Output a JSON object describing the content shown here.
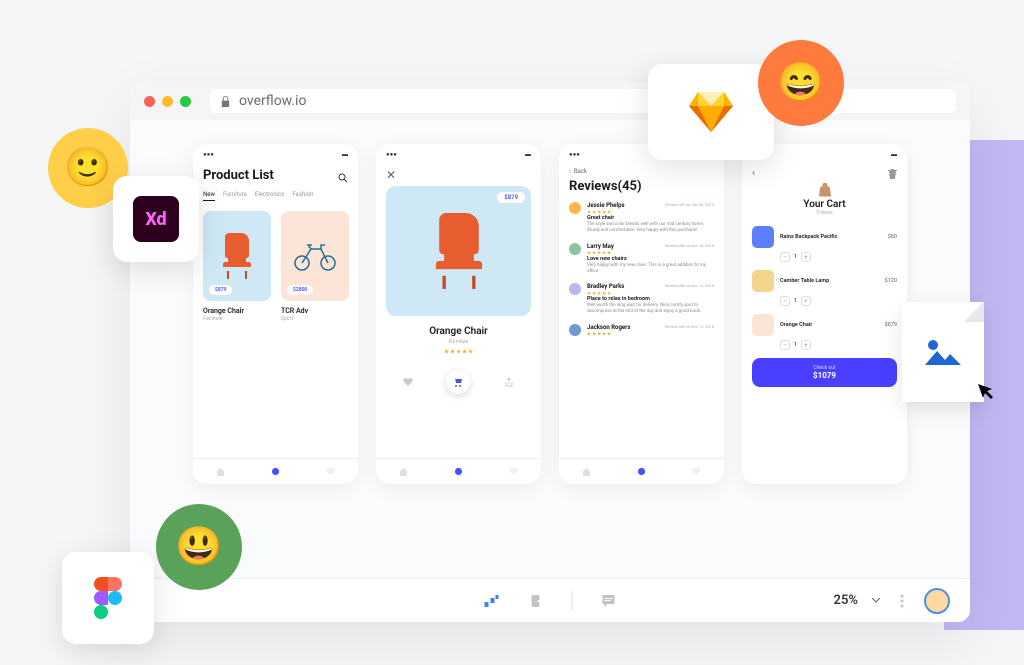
{
  "browser": {
    "url": "overflow.io"
  },
  "screens": {
    "product_list": {
      "title": "Product List",
      "tabs": [
        "New",
        "Furniture",
        "Electronics",
        "Fashion"
      ],
      "active_tab": "New",
      "products": [
        {
          "name": "Orange Chair",
          "category": "Furniture",
          "price": "$879"
        },
        {
          "name": "TCR Adv",
          "category": "Sport",
          "price": "$2800"
        }
      ]
    },
    "product_detail": {
      "name": "Orange Chair",
      "category": "Furniture",
      "price": "$879"
    },
    "reviews": {
      "back": "Back",
      "title": "Reviews(45)",
      "items": [
        {
          "name": "Jessie Phelps",
          "meta": "Review left on Jan 08, 2019",
          "title": "Great chair",
          "text": "The style and color blends well with our mid century home. Sturdy and comfortable. Very happy with this purchase!",
          "color": "#ffb648"
        },
        {
          "name": "Larry May",
          "meta": "Review left on Dec 18, 2018",
          "title": "Love new chairs",
          "text": "Very happy with my new chair. This is a great addition to my office.",
          "color": "#8bc6a1"
        },
        {
          "name": "Bradley Parks",
          "meta": "Review left on Dec 13, 2018",
          "title": "Place to relax in bedroom",
          "text": "Well worth the long wait for delivery. Nice comfy spot to decompress at the end of the day and enjoy a good book.",
          "color": "#b8b8e6"
        },
        {
          "name": "Jackson Rogers",
          "meta": "Review left on Dec 12, 2018",
          "title": "",
          "text": "",
          "color": "#6b9bd1"
        }
      ]
    },
    "cart": {
      "title": "Your Cart",
      "subtitle": "3 items",
      "items": [
        {
          "name": "Rains Backpack Pacific",
          "price": "$80",
          "qty": "1",
          "color": "#5b7fff"
        },
        {
          "name": "Camber Table Lamp",
          "price": "$120",
          "qty": "1",
          "color": "#f4d58d"
        },
        {
          "name": "Orange Chair",
          "price": "$879",
          "qty": "1",
          "color": "#fce4d6"
        }
      ],
      "checkout_label": "Check out",
      "checkout_total": "$1079"
    }
  },
  "bottombar": {
    "zoom": "25%"
  }
}
